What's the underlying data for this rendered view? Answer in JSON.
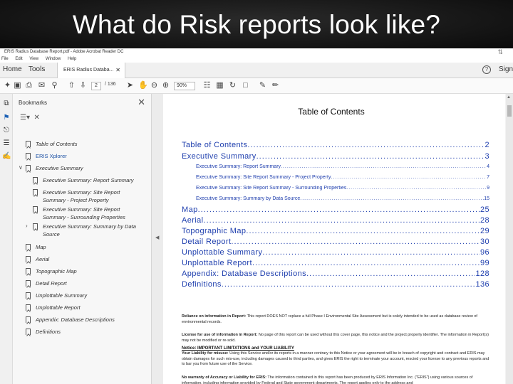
{
  "slide": {
    "title": "What do Risk reports look like?"
  },
  "window": {
    "title": "ERIS Radius Database Report.pdf - Adobe Acrobat Reader DC",
    "menu": [
      "File",
      "Edit",
      "View",
      "Window",
      "Help"
    ]
  },
  "tabs": {
    "home": "Home",
    "tools": "Tools",
    "document": "ERIS Radius Databa...",
    "sign_in": "Sign"
  },
  "toolbar": {
    "page_current": "2",
    "page_total": "/ 136",
    "zoom": "90%"
  },
  "bookmarks": {
    "header": "Bookmarks",
    "items": [
      {
        "label": "Table of Contents",
        "level": 0
      },
      {
        "label": "ERIS Xplorer",
        "level": 0,
        "selected": true
      },
      {
        "label": "Executive Summary",
        "level": 0,
        "expanded": true
      },
      {
        "label": "Executive Summary: Report Summary",
        "level": 1
      },
      {
        "label": "Executive Summary: Site Report Summary - Project Property",
        "level": 1
      },
      {
        "label": "Executive Summary: Site Report Summary - Surrounding Properties",
        "level": 1
      },
      {
        "label": "Executive Summary: Summary by Data Source",
        "level": 1,
        "collapsed": true
      },
      {
        "label": "Map",
        "level": 0
      },
      {
        "label": "Aerial",
        "level": 0
      },
      {
        "label": "Topographic Map",
        "level": 0
      },
      {
        "label": "Detail Report",
        "level": 0
      },
      {
        "label": "Unplottable Summary",
        "level": 0
      },
      {
        "label": "Unplottable Report",
        "level": 0
      },
      {
        "label": "Appendix: Database Descriptions",
        "level": 0
      },
      {
        "label": "Definitions",
        "level": 0
      }
    ]
  },
  "document": {
    "toc_title": "Table of Contents",
    "toc": [
      {
        "label": "Table of Contents",
        "page": "2",
        "type": "main"
      },
      {
        "label": "Executive Summary",
        "page": "3",
        "type": "main"
      },
      {
        "label": "Executive Summary: Report Summary",
        "page": "4",
        "type": "sub"
      },
      {
        "label": "Executive Summary: Site Report Summary - Project Property",
        "page": "7",
        "type": "sub"
      },
      {
        "label": "Executive Summary: Site Report Summary - Surrounding Properties",
        "page": "9",
        "type": "sub"
      },
      {
        "label": "Executive Summary: Summary by Data Source",
        "page": "15",
        "type": "sub"
      },
      {
        "label": "Map",
        "page": "25",
        "type": "main"
      },
      {
        "label": "Aerial",
        "page": "28",
        "type": "main"
      },
      {
        "label": "Topographic Map",
        "page": "29",
        "type": "main"
      },
      {
        "label": "Detail Report",
        "page": "30",
        "type": "main"
      },
      {
        "label": "Unplottable Summary",
        "page": "96",
        "type": "main"
      },
      {
        "label": "Unplottable Report",
        "page": "99",
        "type": "main"
      },
      {
        "label": "Appendix: Database Descriptions",
        "page": "128",
        "type": "main"
      },
      {
        "label": "Definitions",
        "page": "136",
        "type": "main"
      }
    ],
    "notice": {
      "title": "Notice: IMPORTANT LIMITATIONS and YOUR LIABILITY",
      "paragraphs": [
        {
          "lead": "Reliance on information in Report:",
          "text": " This report DOES NOT replace a full Phase I Environmental Site Assessment but is solely intended to be used as database review of environmental records."
        },
        {
          "lead": "License for use of information in Report:",
          "text": " No page of this report can be used without this cover page, this notice and the project property identifier. The information in Report(s) may not be modified or re-sold."
        },
        {
          "lead": "Your Liability for misuse:",
          "text": " Using this Service and/or its reports in a manner contrary to this Notice or your agreement will be in breach of copyright and contract and ERIS may obtain damages for such mis-use, including damages caused to third parties, and gives ERIS the right to terminate your account, rescind your license to any previous reports and to bar you from future use of the Service."
        },
        {
          "lead": "No warranty of Accuracy or Liability for ERIS:",
          "text": " The information contained in this report has been produced by ERIS Information Inc. (\"ERIS\") using various sources of information, including information provided by Federal and State government departments. The report applies only to the address and"
        }
      ]
    }
  }
}
